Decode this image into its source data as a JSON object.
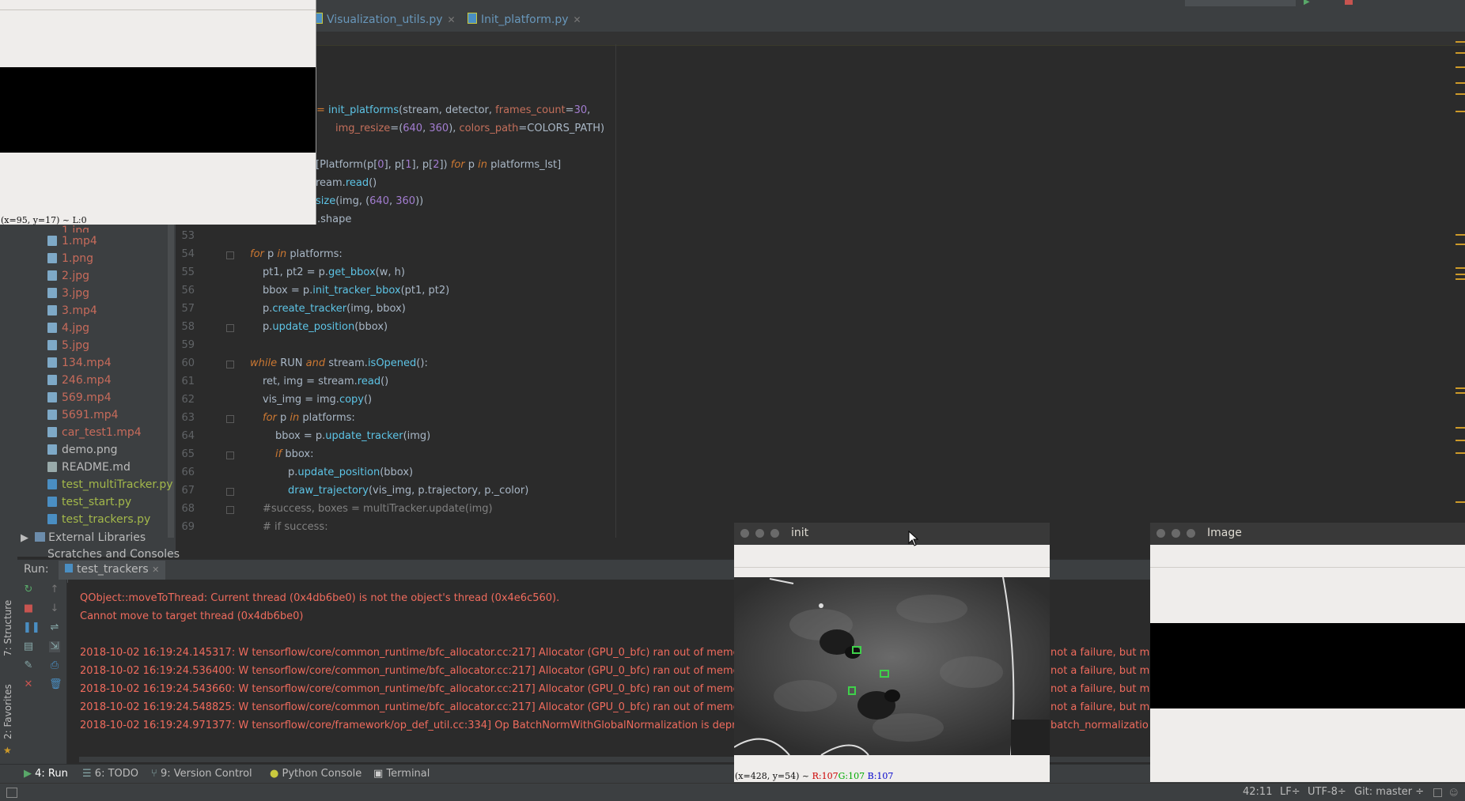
{
  "tabs": [
    {
      "label": "Visualization_utils.py"
    },
    {
      "label": "Init_platform.py"
    }
  ],
  "run_config": "test_trackers",
  "code": {
    "partial_lines": [
      {
        "segs": [
          {
            "t": "= ",
            "c": "op"
          },
          {
            "t": "init_platforms",
            "c": "fn"
          },
          {
            "t": "(stream, detector, ",
            "c": ""
          },
          {
            "t": "frames_count",
            "c": "par"
          },
          {
            "t": "=",
            "c": ""
          },
          {
            "t": "30",
            "c": "num"
          },
          {
            "t": ",",
            "c": ""
          }
        ]
      },
      {
        "segs": [
          {
            "t": "img_resize",
            "c": "par"
          },
          {
            "t": "=(",
            "c": ""
          },
          {
            "t": "640",
            "c": "num"
          },
          {
            "t": ", ",
            "c": ""
          },
          {
            "t": "360",
            "c": "num"
          },
          {
            "t": "), ",
            "c": ""
          },
          {
            "t": "colors_path",
            "c": "par"
          },
          {
            "t": "=COLORS_PATH)",
            "c": ""
          }
        ]
      },
      {
        "segs": [
          {
            "t": "[Platform(p[",
            "c": ""
          },
          {
            "t": "0",
            "c": "num"
          },
          {
            "t": "], p[",
            "c": ""
          },
          {
            "t": "1",
            "c": "num"
          },
          {
            "t": "], p[",
            "c": ""
          },
          {
            "t": "2",
            "c": "num"
          },
          {
            "t": "]) ",
            "c": ""
          },
          {
            "t": "for",
            "c": "kw"
          },
          {
            "t": " p ",
            "c": ""
          },
          {
            "t": "in",
            "c": "kw"
          },
          {
            "t": " platforms_lst]",
            "c": ""
          }
        ]
      },
      {
        "segs": [
          {
            "t": "ream.",
            "c": ""
          },
          {
            "t": "read",
            "c": "fn"
          },
          {
            "t": "()",
            "c": ""
          }
        ]
      },
      {
        "segs": [
          {
            "t": "size",
            "c": "fn"
          },
          {
            "t": "(img, (",
            "c": ""
          },
          {
            "t": "640",
            "c": "num"
          },
          {
            "t": ", ",
            "c": ""
          },
          {
            "t": "360",
            "c": "num"
          },
          {
            "t": "))",
            "c": ""
          }
        ]
      },
      {
        "segs": [
          {
            "t": ".shape",
            "c": ""
          }
        ]
      }
    ],
    "lines": [
      {
        "n": "53",
        "segs": []
      },
      {
        "n": "54",
        "segs": [
          {
            "t": "for",
            "c": "kw"
          },
          {
            "t": " p ",
            "c": ""
          },
          {
            "t": "in",
            "c": "kw"
          },
          {
            "t": " platforms:",
            "c": ""
          }
        ]
      },
      {
        "n": "55",
        "segs": [
          {
            "t": "pt1, pt2 = p.",
            "c": ""
          },
          {
            "t": "get_bbox",
            "c": "fn"
          },
          {
            "t": "(w, h)",
            "c": ""
          }
        ]
      },
      {
        "n": "56",
        "segs": [
          {
            "t": "bbox = p.",
            "c": ""
          },
          {
            "t": "init_tracker_bbox",
            "c": "fn"
          },
          {
            "t": "(pt1, pt2)",
            "c": ""
          }
        ]
      },
      {
        "n": "57",
        "segs": [
          {
            "t": "p.",
            "c": ""
          },
          {
            "t": "create_tracker",
            "c": "fn"
          },
          {
            "t": "(img, bbox)",
            "c": ""
          }
        ]
      },
      {
        "n": "58",
        "segs": [
          {
            "t": "p.",
            "c": ""
          },
          {
            "t": "update_position",
            "c": "fn"
          },
          {
            "t": "(bbox)",
            "c": ""
          }
        ]
      },
      {
        "n": "59",
        "segs": []
      },
      {
        "n": "60",
        "segs": [
          {
            "t": "while",
            "c": "kw"
          },
          {
            "t": " RUN ",
            "c": ""
          },
          {
            "t": "and",
            "c": "kw"
          },
          {
            "t": " stream.",
            "c": ""
          },
          {
            "t": "isOpened",
            "c": "fn"
          },
          {
            "t": "():",
            "c": ""
          }
        ]
      },
      {
        "n": "61",
        "segs": [
          {
            "t": "ret, img = stream.",
            "c": ""
          },
          {
            "t": "read",
            "c": "fn"
          },
          {
            "t": "()",
            "c": ""
          }
        ]
      },
      {
        "n": "62",
        "segs": [
          {
            "t": "vis_img = img.",
            "c": ""
          },
          {
            "t": "copy",
            "c": "fn"
          },
          {
            "t": "()",
            "c": ""
          }
        ]
      },
      {
        "n": "63",
        "segs": [
          {
            "t": "for",
            "c": "kw"
          },
          {
            "t": " p ",
            "c": ""
          },
          {
            "t": "in",
            "c": "kw"
          },
          {
            "t": " platforms:",
            "c": ""
          }
        ]
      },
      {
        "n": "64",
        "segs": [
          {
            "t": "bbox = p.",
            "c": ""
          },
          {
            "t": "update_tracker",
            "c": "fn"
          },
          {
            "t": "(img)",
            "c": ""
          }
        ]
      },
      {
        "n": "65",
        "segs": [
          {
            "t": "if",
            "c": "kw"
          },
          {
            "t": " bbox:",
            "c": ""
          }
        ]
      },
      {
        "n": "66",
        "segs": [
          {
            "t": "p.",
            "c": ""
          },
          {
            "t": "update_position",
            "c": "fn"
          },
          {
            "t": "(bbox)",
            "c": ""
          }
        ]
      },
      {
        "n": "67",
        "segs": [
          {
            "t": "draw_trajectory",
            "c": "fn"
          },
          {
            "t": "(vis_img, p.trajectory, p._color)",
            "c": ""
          }
        ]
      },
      {
        "n": "68",
        "segs": [
          {
            "t": "#success, boxes = multiTracker.update(img)",
            "c": "cm"
          }
        ]
      },
      {
        "n": "69",
        "segs": [
          {
            "t": "# if success:",
            "c": "cm"
          }
        ]
      }
    ]
  },
  "project_tree": {
    "items": [
      {
        "label": "1.mp4",
        "color": "#c76b5b",
        "icon": "video-file-icon"
      },
      {
        "label": "1.png",
        "color": "#c76b5b",
        "icon": "image-file-icon"
      },
      {
        "label": "2.jpg",
        "color": "#c76b5b",
        "icon": "image-file-icon"
      },
      {
        "label": "3.jpg",
        "color": "#c76b5b",
        "icon": "image-file-icon"
      },
      {
        "label": "3.mp4",
        "color": "#c76b5b",
        "icon": "video-file-icon"
      },
      {
        "label": "4.jpg",
        "color": "#c76b5b",
        "icon": "image-file-icon"
      },
      {
        "label": "5.jpg",
        "color": "#c76b5b",
        "icon": "image-file-icon"
      },
      {
        "label": "134.mp4",
        "color": "#c76b5b",
        "icon": "video-file-icon"
      },
      {
        "label": "246.mp4",
        "color": "#c76b5b",
        "icon": "video-file-icon"
      },
      {
        "label": "569.mp4",
        "color": "#c76b5b",
        "icon": "video-file-icon"
      },
      {
        "label": "5691.mp4",
        "color": "#c76b5b",
        "icon": "video-file-icon"
      },
      {
        "label": "car_test1.mp4",
        "color": "#c76b5b",
        "icon": "video-file-icon"
      },
      {
        "label": "demo.png",
        "color": "#bbbbbb",
        "icon": "image-file-icon"
      },
      {
        "label": "README.md",
        "color": "#bbbbbb",
        "icon": "markdown-file-icon"
      },
      {
        "label": "test_multiTracker.py",
        "color": "#a3b84a",
        "icon": "python-file-icon"
      },
      {
        "label": "test_start.py",
        "color": "#a3b84a",
        "icon": "python-file-icon"
      },
      {
        "label": "test_trackers.py",
        "color": "#a3b84a",
        "icon": "python-file-icon"
      }
    ],
    "external_libraries": "External Libraries",
    "scratches": "Scratches and Consoles"
  },
  "run": {
    "label": "Run:",
    "tab": "test_trackers",
    "lines": [
      "QObject::moveToThread: Current thread (0x4db6be0) is not the object's thread (0x4e6c560).",
      "Cannot move to target thread (0x4db6be0)",
      "",
      "2018-10-02 16:19:24.145317: W tensorflow/core/common_runtime/bfc_allocator.cc:217] Allocator (GPU_0_bfc) ran out of memc",
      "2018-10-02 16:19:24.536400: W tensorflow/core/common_runtime/bfc_allocator.cc:217] Allocator (GPU_0_bfc) ran out of memc",
      "2018-10-02 16:19:24.543660: W tensorflow/core/common_runtime/bfc_allocator.cc:217] Allocator (GPU_0_bfc) ran out of memc",
      "2018-10-02 16:19:24.548825: W tensorflow/core/common_runtime/bfc_allocator.cc:217] Allocator (GPU_0_bfc) ran out of memc",
      "2018-10-02 16:19:24.971377: W tensorflow/core/framework/op_def_util.cc:334] Op BatchNormWithGlobalNormalization is depr"
    ],
    "tail_lines": [
      "not a failure, but ma",
      "not a failure, but ma",
      "not a failure, but ma",
      "not a failure, but ma",
      "batch_normalizatio"
    ]
  },
  "side_labels": {
    "structure": "7: Structure",
    "favorites": "2: Favorites"
  },
  "bottom_tools": [
    {
      "label": "4: Run",
      "icon": "run-icon"
    },
    {
      "label": "6: TODO",
      "icon": "todo-icon"
    },
    {
      "label": "9: Version Control",
      "icon": "vcs-icon"
    },
    {
      "label": "Python Console",
      "icon": "python-console-icon"
    },
    {
      "label": "Terminal",
      "icon": "terminal-icon"
    }
  ],
  "status": {
    "position": "42:11",
    "line_sep": "LF÷",
    "encoding": "UTF-8÷",
    "git": "Git: master ÷"
  },
  "windows": {
    "topleft": {
      "status": "(x=95, y=17) ~ L:0",
      "partial": "1.jpg"
    },
    "init": {
      "title": "init",
      "status_prefix": "(x=428, y=54) ~ ",
      "r": "R:107",
      "g": "G:107",
      "b": "B:107"
    },
    "image": {
      "title": "Image"
    }
  },
  "colors": {
    "bg": "#2b2b2b",
    "panel": "#3c3f41",
    "keyword": "#cc7832",
    "function": "#5dc4e6",
    "number": "#a37dd1",
    "param": "#c46f5b",
    "error": "#ef6b5d"
  }
}
